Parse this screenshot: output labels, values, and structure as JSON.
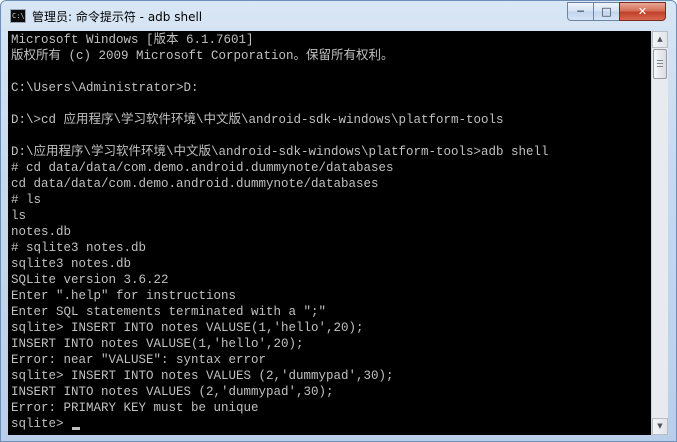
{
  "window": {
    "title": "管理员: 命令提示符 - adb  shell",
    "app_icon_text": "C:\\",
    "buttons": {
      "minimize": "─",
      "maximize": "□",
      "close": "✕"
    }
  },
  "colors": {
    "console_bg": "#000000",
    "console_fg": "#c0c0c0",
    "titlebar": "#c6d9ef",
    "close_button": "#c2402a"
  },
  "console": {
    "lines": [
      "Microsoft Windows [版本 6.1.7601]",
      "版权所有 (c) 2009 Microsoft Corporation。保留所有权利。",
      "",
      "C:\\Users\\Administrator>D:",
      "",
      "D:\\>cd 应用程序\\学习软件环境\\中文版\\android-sdk-windows\\platform-tools",
      "",
      "D:\\应用程序\\学习软件环境\\中文版\\android-sdk-windows\\platform-tools>adb shell",
      "# cd data/data/com.demo.android.dummynote/databases",
      "cd data/data/com.demo.android.dummynote/databases",
      "# ls",
      "ls",
      "notes.db",
      "# sqlite3 notes.db",
      "sqlite3 notes.db",
      "SQLite version 3.6.22",
      "Enter \".help\" for instructions",
      "Enter SQL statements terminated with a \";\"",
      "sqlite> INSERT INTO notes VALUSE(1,'hello',20);",
      "INSERT INTO notes VALUSE(1,'hello',20);",
      "Error: near \"VALUSE\": syntax error",
      "sqlite> INSERT INTO notes VALUES (2,'dummypad',30);",
      "INSERT INTO notes VALUES (2,'dummypad',30);",
      "Error: PRIMARY KEY must be unique",
      "sqlite> "
    ]
  },
  "scrollbar": {
    "up_arrow": "▲",
    "down_arrow": "▼"
  }
}
